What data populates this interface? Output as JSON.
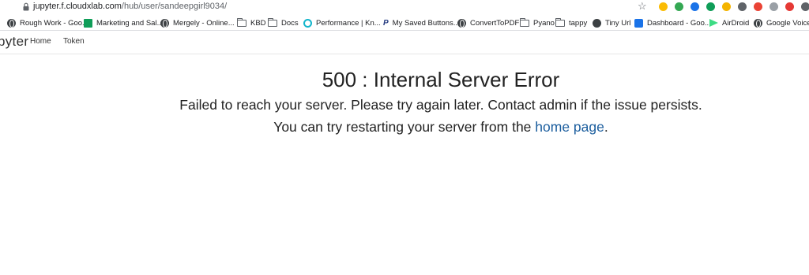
{
  "browser": {
    "url_host": "jupyter.f.cloudxlab.com",
    "url_path": "/hub/user/sandeepgirl9034/",
    "extension_icons": [
      {
        "name": "chrome-extension-icon-1",
        "color": "#fbbc04"
      },
      {
        "name": "chrome-extension-icon-2",
        "color": "#34a853"
      },
      {
        "name": "chrome-extension-icon-3",
        "color": "#1a73e8"
      },
      {
        "name": "chrome-extension-icon-4",
        "color": "#0f9d58"
      },
      {
        "name": "chrome-extension-icon-5",
        "color": "#f4b400"
      },
      {
        "name": "chrome-extension-icon-6",
        "color": "#5f6368"
      },
      {
        "name": "chrome-extension-icon-7",
        "color": "#ea4335"
      },
      {
        "name": "chrome-extension-icon-8",
        "color": "#9aa0a6"
      },
      {
        "name": "chrome-extension-icon-9",
        "color": "#e53935"
      },
      {
        "name": "chrome-extension-icon-10",
        "color": "#5f6368"
      },
      {
        "name": "chrome-extension-icon-11",
        "color": "#0f9d58"
      }
    ]
  },
  "bookmarks": [
    {
      "label": "Rough Work - Goo...",
      "icon": "globe-icon"
    },
    {
      "label": "Marketing and Sal...",
      "icon": "sheets-icon"
    },
    {
      "label": "Mergely - Online...",
      "icon": "globe-icon"
    },
    {
      "label": "KBD",
      "icon": "folder-icon"
    },
    {
      "label": "Docs",
      "icon": "folder-icon"
    },
    {
      "label": "Performance | Kn...",
      "icon": "performance-icon"
    },
    {
      "label": "My Saved Buttons...",
      "icon": "paypal-icon"
    },
    {
      "label": "ConvertToPDF",
      "icon": "globe-icon"
    },
    {
      "label": "Pyano",
      "icon": "folder-icon"
    },
    {
      "label": "tappy",
      "icon": "folder-icon"
    },
    {
      "label": "Tiny Url",
      "icon": "globe-icon"
    },
    {
      "label": "Dashboard - Goo...",
      "icon": "dashboard-icon"
    },
    {
      "label": "AirDroid",
      "icon": "airdroid-icon"
    },
    {
      "label": "Google Voice -",
      "icon": "globe-icon"
    }
  ],
  "header": {
    "logo_text": "pyter",
    "nav": [
      "Home",
      "Token"
    ]
  },
  "error": {
    "title": "500 : Internal Server Error",
    "message": "Failed to reach your server. Please try again later. Contact admin if the issue persists.",
    "restart_prefix": "You can try restarting your server from the ",
    "restart_link": "home page",
    "restart_suffix": "."
  }
}
